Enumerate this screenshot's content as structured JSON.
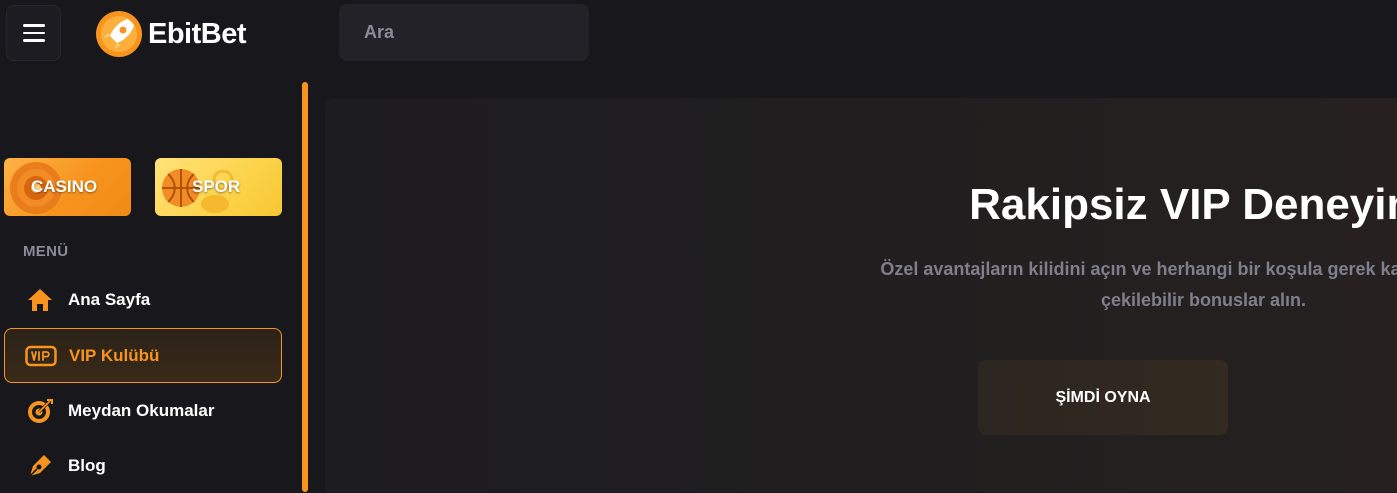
{
  "header": {
    "brand": "EbitBet",
    "search_placeholder": "Ara"
  },
  "sidebar": {
    "categories": [
      {
        "label": "CASINO"
      },
      {
        "label": "SPOR"
      }
    ],
    "menu_heading": "MENÜ",
    "items": [
      {
        "label": "Ana Sayfa",
        "icon": "home-icon",
        "active": false
      },
      {
        "label": "VIP Kulübü",
        "icon": "vip-icon",
        "active": true
      },
      {
        "label": "Meydan Okumalar",
        "icon": "target-icon",
        "active": false
      },
      {
        "label": "Blog",
        "icon": "pen-icon",
        "active": false
      }
    ]
  },
  "hero": {
    "title": "Rakipsiz VIP Deneyimi",
    "subtitle_line1": "Özel avantajların kilidini açın ve herhangi bir koşula gerek kalmadan anında",
    "subtitle_line2": "çekilebilir bonuslar alın.",
    "cta": "ŞİMDİ OYNA"
  },
  "colors": {
    "accent": "#f7941e",
    "background": "#17171c",
    "muted_text": "#8b8b99"
  }
}
